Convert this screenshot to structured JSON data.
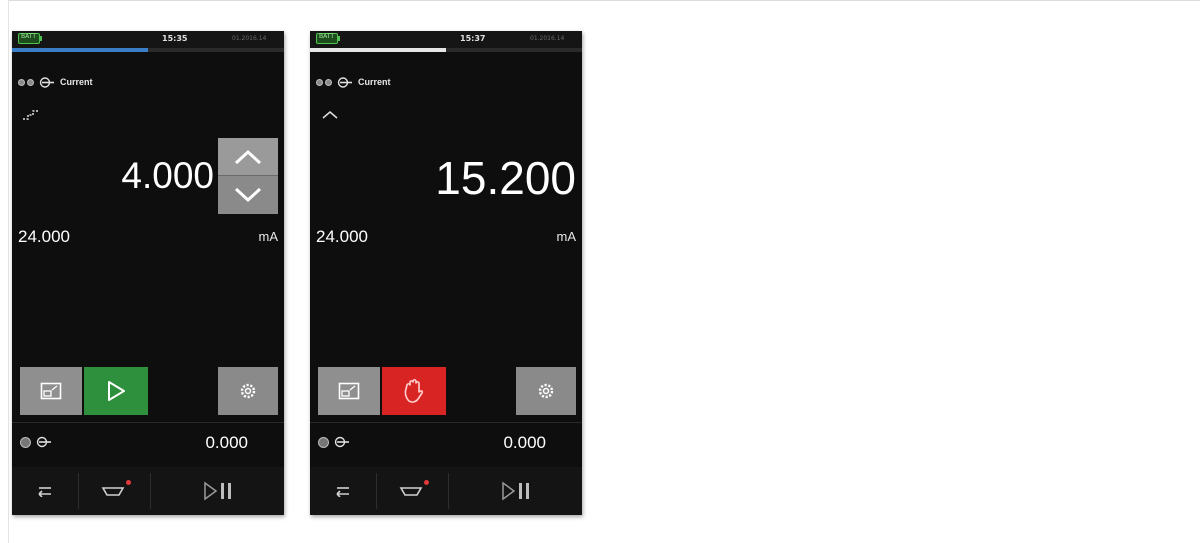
{
  "screens": [
    {
      "status": {
        "battery_label": "BATT",
        "time": "15:35",
        "date": "01.2016.14"
      },
      "progress_fraction": 0.5,
      "channel_label": "Current",
      "mode_icon": "step-icon",
      "main_value": "4.000",
      "range_value": "24.000",
      "unit": "mA",
      "action_button": {
        "icon": "play-icon",
        "color": "#2e8f3c"
      },
      "secondary_value": "0.000",
      "footer_icons": [
        "back-icon",
        "sensor-icon",
        "play-pause-icon"
      ]
    },
    {
      "status": {
        "battery_label": "BATT",
        "time": "15:37",
        "date": "01.2016.14"
      },
      "progress_fraction": 0.5,
      "channel_label": "Current",
      "mode_icon": "ramp-icon",
      "main_value": "15.200",
      "range_value": "24.000",
      "unit": "mA",
      "action_button": {
        "icon": "hand-stop-icon",
        "color": "#d92424"
      },
      "secondary_value": "0.000",
      "footer_icons": [
        "back-icon",
        "sensor-icon",
        "play-pause-icon"
      ]
    }
  ],
  "colors": {
    "screen_bg": "#0e0e0e",
    "progress_blue": "#3a7ec8",
    "alert_red": "#e23a3a"
  }
}
